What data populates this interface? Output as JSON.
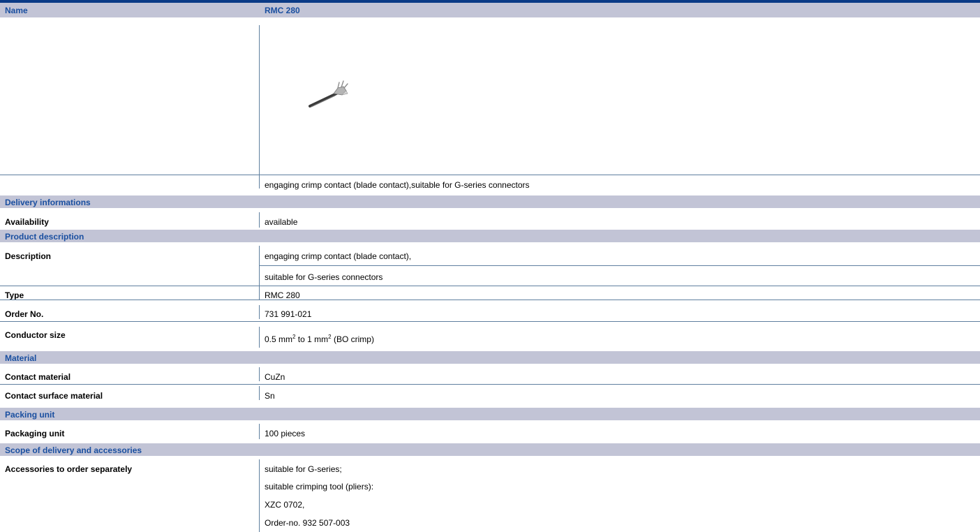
{
  "header": {
    "name_label": "Name",
    "name_value": "RMC 280"
  },
  "product_image": {
    "icon": "crimp-contact-image"
  },
  "caption": "engaging crimp contact (blade contact),suitable for G-series connectors",
  "sections": {
    "delivery": {
      "title": "Delivery informations",
      "availability": {
        "label": "Availability",
        "value": "available"
      }
    },
    "product": {
      "title": "Product description",
      "description": {
        "label": "Description",
        "lines": [
          "engaging crimp contact (blade contact),",
          "suitable for G-series connectors"
        ]
      },
      "type": {
        "label": "Type",
        "value": "RMC 280"
      },
      "order_no": {
        "label": "Order No.",
        "value": "731 991-021"
      },
      "conductor_size": {
        "label": "Conductor size",
        "p1": "0.5 mm",
        "sup1": "2",
        "p2": " to 1 mm",
        "sup2": "2",
        "p3": " (BO crimp)"
      }
    },
    "material": {
      "title": "Material",
      "contact_material": {
        "label": "Contact material",
        "value": "CuZn"
      },
      "surface_material": {
        "label": "Contact surface material",
        "value": "Sn"
      }
    },
    "packing": {
      "title": "Packing unit",
      "packaging_unit": {
        "label": "Packaging unit",
        "value": "100 pieces"
      }
    },
    "scope": {
      "title": "Scope of delivery and accessories",
      "accessories": {
        "label": "Accessories to order separately",
        "lines": [
          "suitable for G-series;",
          "suitable crimping tool (pliers):",
          "XZC 0702,",
          "Order-no. 932 507-003"
        ]
      }
    }
  },
  "colors": {
    "header_band": "#c2c4d6",
    "accent_text": "#1a4fa0",
    "top_bar": "#0a3a86",
    "rule": "#5f7f9f"
  }
}
